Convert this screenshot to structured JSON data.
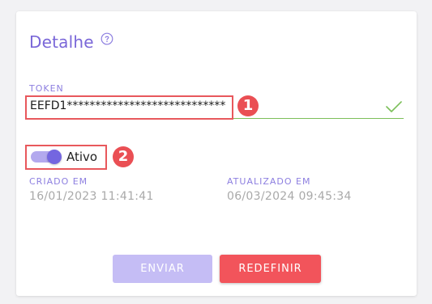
{
  "card": {
    "title": "Detalhe"
  },
  "token": {
    "label": "TOKEN",
    "value": "EEFD1****************************"
  },
  "status": {
    "toggle_label": "Ativo",
    "enabled": true
  },
  "meta": {
    "created_label": "CRIADO EM",
    "created_value": "16/01/2023 11:41:41",
    "updated_label": "ATUALIZADO EM",
    "updated_value": "06/03/2024 09:45:34"
  },
  "actions": {
    "send_label": "ENVIAR",
    "reset_label": "REDEFINIR"
  },
  "annotations": {
    "marker_1": "1",
    "marker_2": "2"
  },
  "icons": {
    "help": "help-circle-icon",
    "valid": "check-icon"
  },
  "colors": {
    "accent": "#7a67d8",
    "valid": "#7cbf5a",
    "danger": "#f2545b",
    "disabled_primary": "#c5bdf5"
  }
}
